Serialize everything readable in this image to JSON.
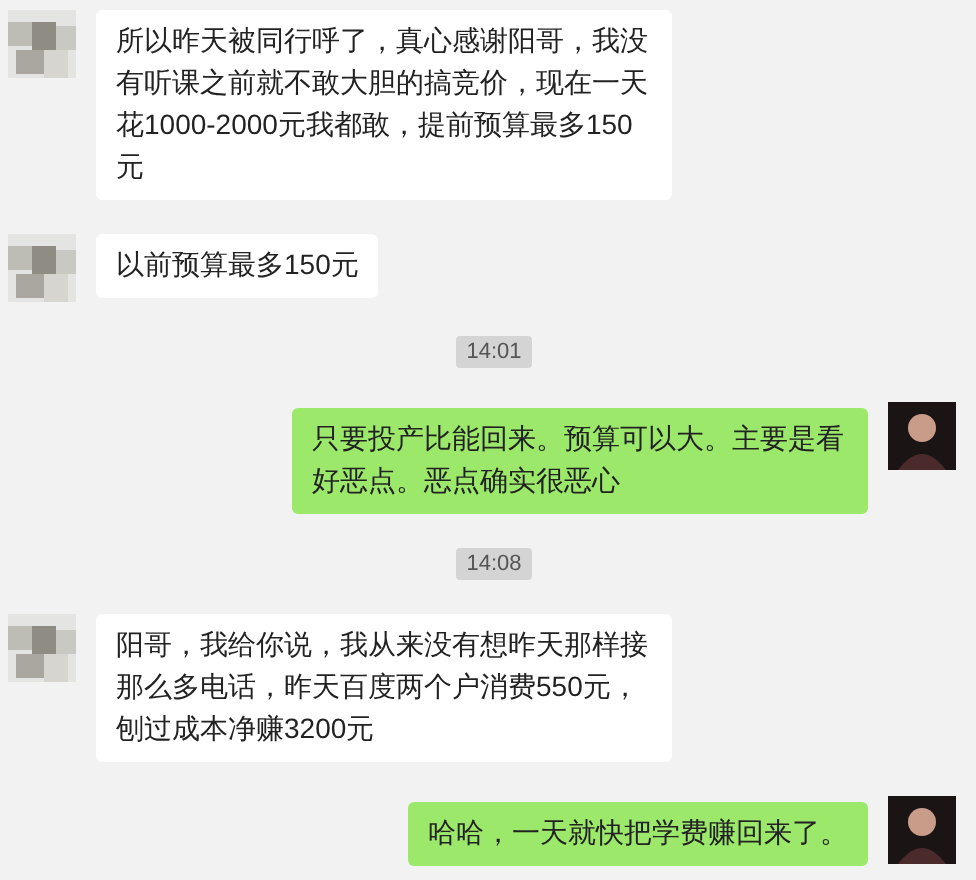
{
  "messages": [
    {
      "kind": "incoming",
      "text": "所以昨天被同行呼了，真心感谢阳哥，我没有听课之前就不敢大胆的搞竞价，现在一天花1000-2000元我都敢，提前预算最多150元"
    },
    {
      "kind": "incoming",
      "text": "以前预算最多150元"
    },
    {
      "kind": "time",
      "text": "14:01"
    },
    {
      "kind": "outgoing",
      "text": "只要投产比能回来。预算可以大。主要是看好恶点。恶点确实很恶心"
    },
    {
      "kind": "time",
      "text": "14:08"
    },
    {
      "kind": "incoming",
      "text": "阳哥，我给你说，我从来没有想昨天那样接那么多电话，昨天百度两个户消费550元，刨过成本净赚3200元"
    },
    {
      "kind": "outgoing",
      "text": "哈哈，一天就快把学费赚回来了。"
    }
  ]
}
